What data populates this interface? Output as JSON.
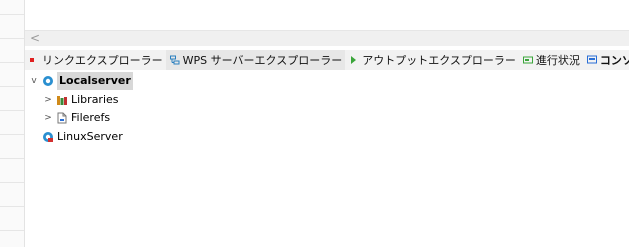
{
  "hscroll": {
    "left_arrow": "<"
  },
  "tabs": [
    {
      "label": "リンクエクスプローラー",
      "icon": "link-explorer-icon",
      "color": "#e02020"
    },
    {
      "label": "WPS サーバーエクスプローラー",
      "icon": "server-explorer-icon",
      "color": "#2a7fbf",
      "active": true
    },
    {
      "label": "アウトプットエクスプローラー",
      "icon": "output-explorer-icon",
      "color": "#3aa53a"
    },
    {
      "label": "進行状況",
      "icon": "progress-icon",
      "color": "#3aa53a"
    },
    {
      "label": "コンソール",
      "icon": "console-icon",
      "color": "#2a6fd6",
      "bold": true
    }
  ],
  "tree": {
    "root": {
      "label": "Localserver",
      "expanded": "v"
    },
    "children": [
      {
        "label": "Libraries",
        "twisty": ">"
      },
      {
        "label": "Filerefs",
        "twisty": ">"
      }
    ],
    "second_root": {
      "label": "LinuxServer"
    }
  }
}
